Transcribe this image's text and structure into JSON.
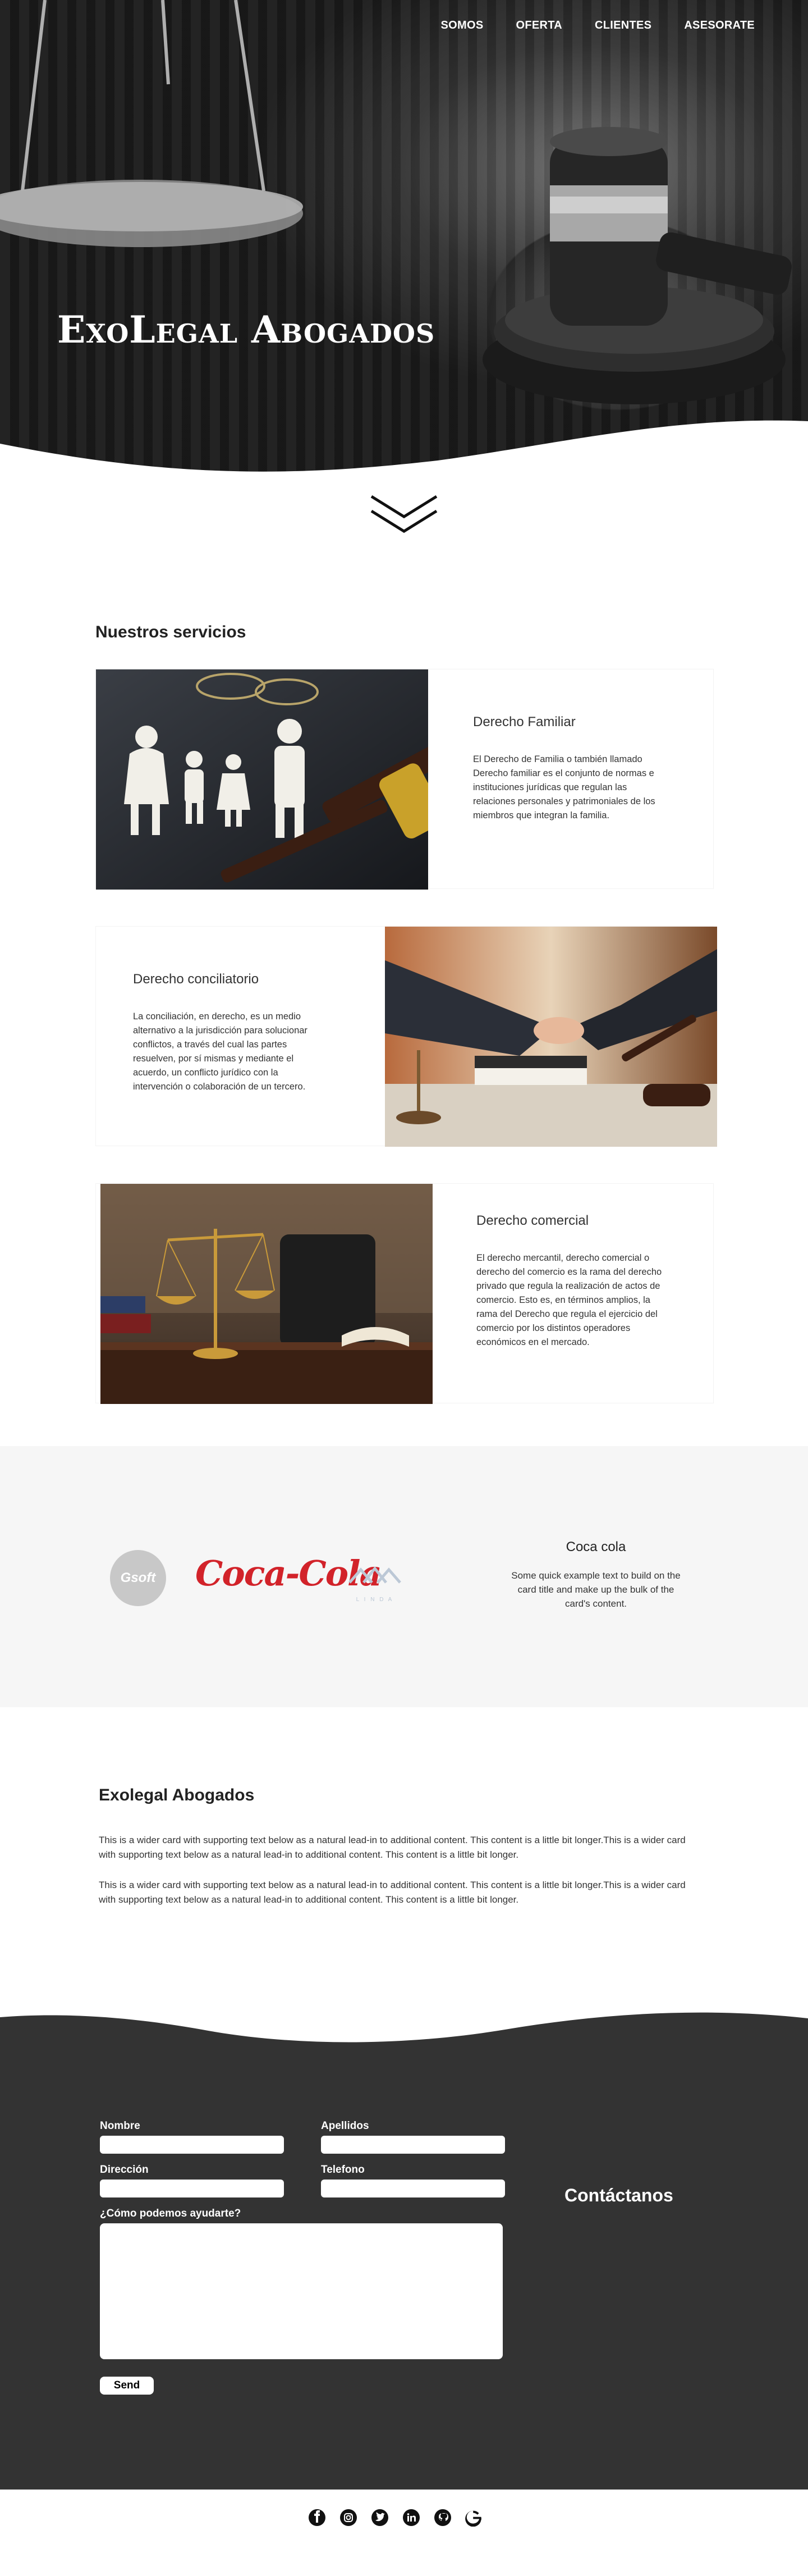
{
  "nav": {
    "items": [
      {
        "label": "SOMOS"
      },
      {
        "label": "OFERTA"
      },
      {
        "label": "CLIENTES"
      },
      {
        "label": "ASESORATE"
      }
    ]
  },
  "hero": {
    "title": "ExoLegal Abogados"
  },
  "services": {
    "heading": "Nuestros servicios",
    "cards": [
      {
        "title": "Derecho Familiar",
        "text": "El Derecho de Familia o también llamado Derecho familiar es el conjunto de normas e instituciones jurídicas que regulan las relaciones personales y patrimoniales de los miembros que integran la familia."
      },
      {
        "title": "Derecho conciliatorio",
        "text": "La conciliación, en derecho, es un medio alternativo a la jurisdicción para solucionar conflictos, a través del cual las partes resuelven, por sí mismas y mediante el acuerdo, un conflicto jurídico con la intervención o colaboración de un tercero."
      },
      {
        "title": "Derecho comercial",
        "text": "El derecho mercantil, derecho comercial o derecho del comercio es la rama del derecho privado que regula la realización de actos de comercio. Esto es, en términos amplios, la rama del Derecho que regula el ejercicio del comercio por los distintos operadores económicos en el mercado."
      }
    ]
  },
  "brands": {
    "logos": [
      {
        "label": "Gsoft"
      },
      {
        "label": "Coca-Cola"
      },
      {
        "label": "L I N D A"
      }
    ],
    "card": {
      "title": "Coca cola",
      "text": "Some quick example text to build on the card title and make up the bulk of the card's content."
    }
  },
  "about": {
    "heading": "Exolegal Abogados",
    "paragraphs": [
      "This is a wider card with supporting text below as a natural lead-in to additional content. This content is a little bit longer.This is a wider card with supporting text below as a natural lead-in to additional content. This content is a little bit longer.",
      "This is a wider card with supporting text below as a natural lead-in to additional content. This content is a little bit longer.This is a wider card with supporting text below as a natural lead-in to additional content. This content is a little bit longer."
    ]
  },
  "contact": {
    "title": "Contáctanos",
    "fields": {
      "nombre": {
        "label": "Nombre",
        "value": ""
      },
      "apellidos": {
        "label": "Apellidos",
        "value": ""
      },
      "direccion": {
        "label": "Dirección",
        "value": ""
      },
      "telefono": {
        "label": "Telefono",
        "value": ""
      },
      "mensaje": {
        "label": "¿Cómo podemos ayudarte?",
        "value": ""
      }
    },
    "send_label": "Send"
  },
  "footer": {
    "icons": [
      "facebook-icon",
      "instagram-icon",
      "twitter-icon",
      "linkedin-icon",
      "github-icon",
      "google-icon"
    ]
  }
}
